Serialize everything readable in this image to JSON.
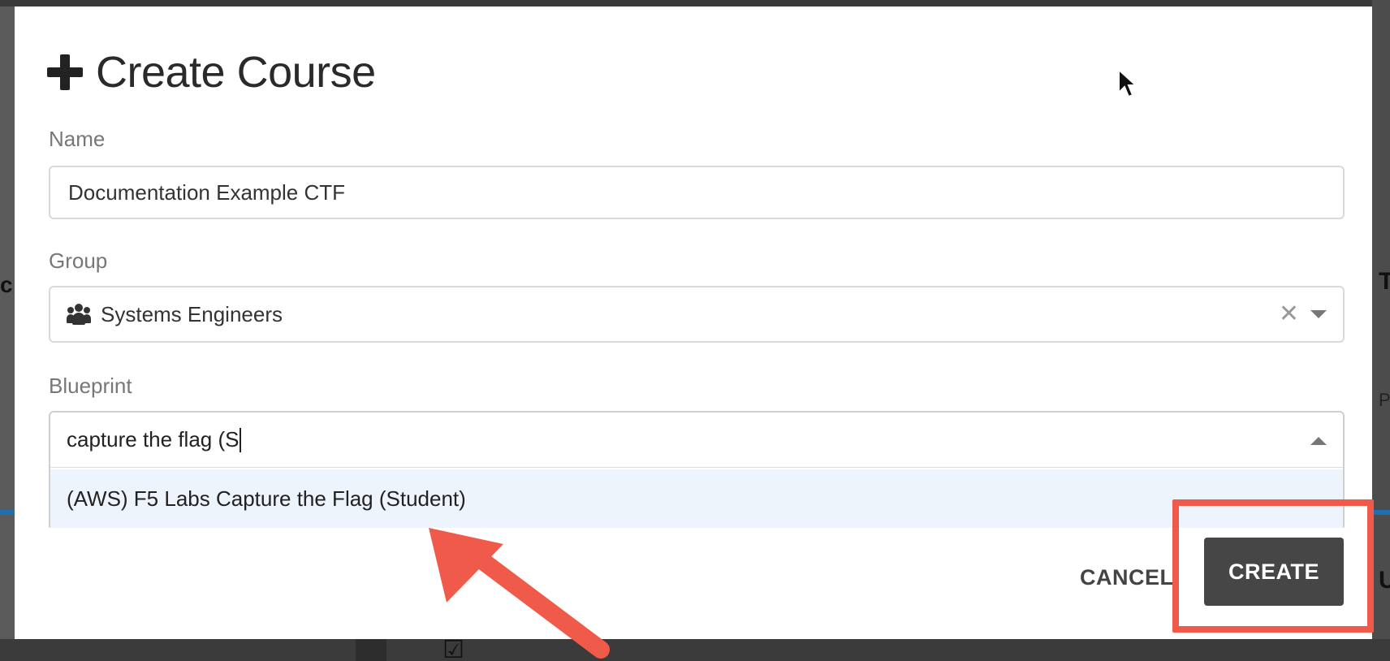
{
  "modal": {
    "title": "Create Course",
    "name_label": "Name",
    "name_value": "Documentation Example CTF",
    "group_label": "Group",
    "group_value": "Systems Engineers",
    "blueprint_label": "Blueprint",
    "blueprint_query": "capture the flag (S",
    "blueprint_options": [
      "(AWS) F5 Labs Capture the Flag (Student)"
    ],
    "cancel_label": "CANCEL",
    "create_label": "CREATE"
  },
  "icons": {
    "title_icon": "plus-icon",
    "group_icon": "users-icon",
    "clear_icon": "close-icon",
    "group_caret": "chevron-down-icon",
    "blueprint_caret": "chevron-up-icon"
  },
  "colors": {
    "annotation": "#f05a4a",
    "create_button": "#464646",
    "option_highlight": "#eef4fc"
  }
}
